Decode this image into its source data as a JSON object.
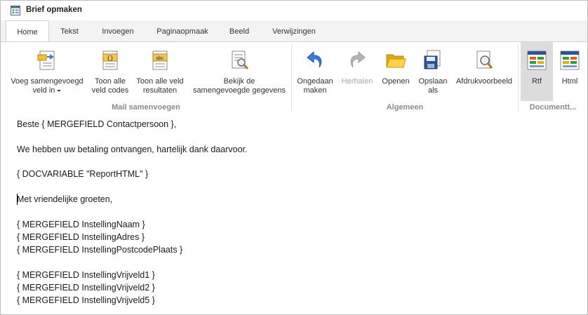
{
  "window": {
    "title": "Brief opmaken",
    "app_icon": "form-icon"
  },
  "tabs": [
    {
      "label": "Home",
      "active": true
    },
    {
      "label": "Tekst"
    },
    {
      "label": "Invoegen"
    },
    {
      "label": "Paginaopmaak"
    },
    {
      "label": "Beeld"
    },
    {
      "label": "Verwijzingen"
    }
  ],
  "ribbon": {
    "mail": {
      "label": "Mail samenvoegen",
      "insert_field": {
        "line1": "Voeg samengevoegd",
        "line2": "veld in"
      },
      "show_codes": {
        "line1": "Toon alle",
        "line2": "veld codes"
      },
      "show_results": {
        "line1": "Toon alle veld",
        "line2": "resultaten"
      },
      "view_merged": {
        "line1": "Bekijk de",
        "line2": "samengevoegde gegevens"
      }
    },
    "general": {
      "label": "Algemeen",
      "undo": {
        "line1": "Ongedaan",
        "line2": "maken"
      },
      "redo": {
        "line1": "Herhalen"
      },
      "open": {
        "line1": "Openen"
      },
      "save": {
        "line1": "Opslaan",
        "line2": "als"
      },
      "print_preview": {
        "line1": "Afdrukvoorbeeld"
      }
    },
    "document": {
      "label": "Documentt...",
      "rtf": {
        "line1": "Rtf",
        "selected": true
      },
      "html": {
        "line1": "Html"
      }
    }
  },
  "document": {
    "lines": [
      "Beste { MERGEFIELD Contactpersoon },",
      "",
      "We hebben uw betaling ontvangen, hartelijk dank daarvoor.",
      "",
      "{ DOCVARIABLE \"ReportHTML\" }",
      "",
      "Met vriendelijke groeten,",
      "",
      "{ MERGEFIELD InstellingNaam }",
      "{ MERGEFIELD InstellingAdres }",
      "{ MERGEFIELD InstellingPostcodePlaats }",
      "",
      "{ MERGEFIELD InstellingVrijveld1 }",
      "{ MERGEFIELD InstellingVrijveld2 }",
      "{ MERGEFIELD InstellingVrijveld5 }"
    ]
  }
}
